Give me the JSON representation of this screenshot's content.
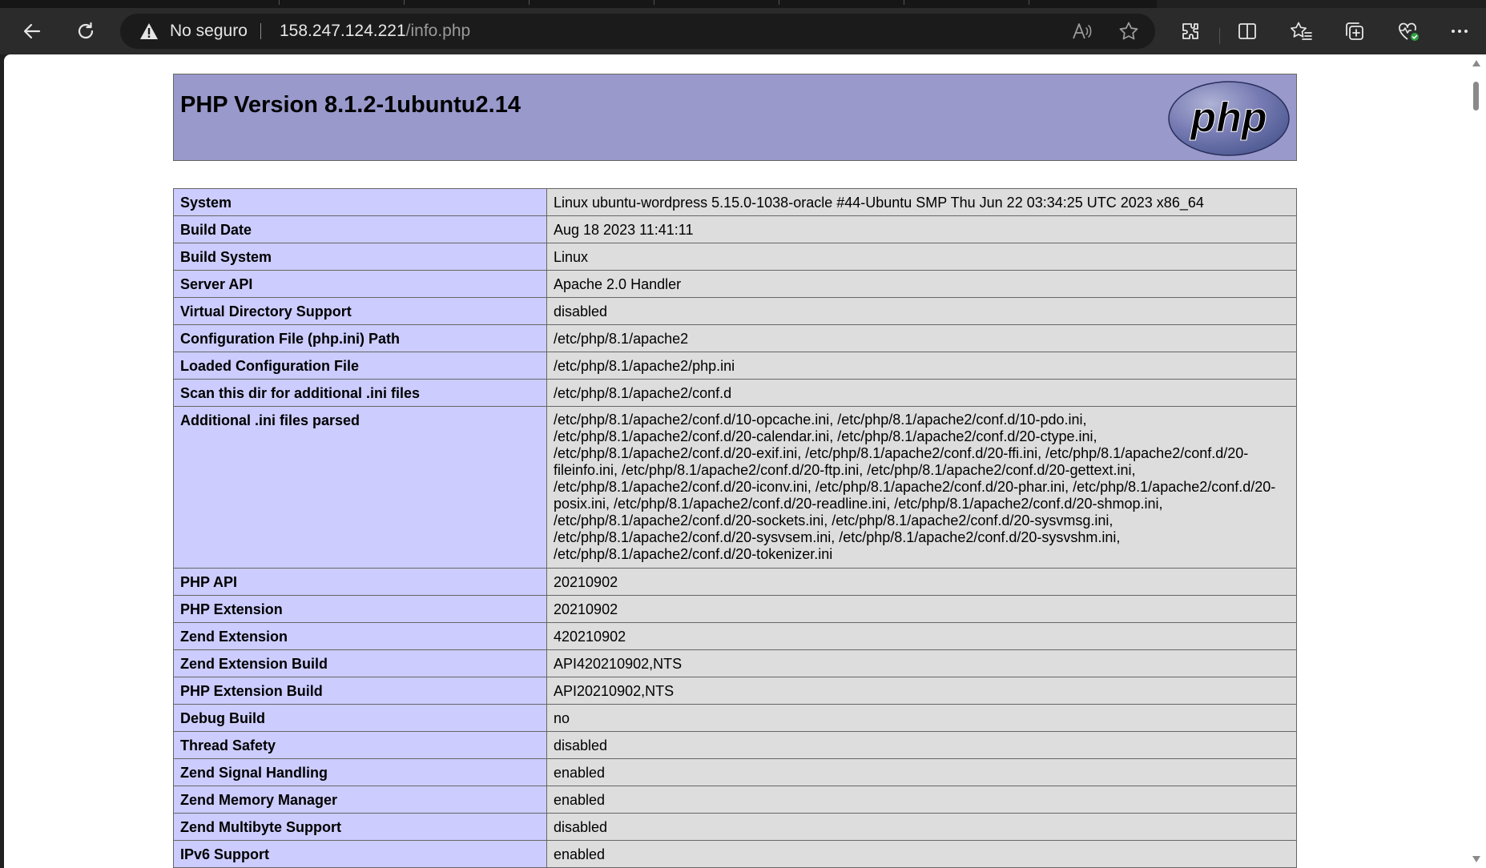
{
  "browser": {
    "security_label": "No seguro",
    "url_host": "158.247.124.221",
    "url_path": "/info.php",
    "icons": [
      "back-icon",
      "refresh-icon",
      "warning-icon",
      "read-aloud-icon",
      "favorite-star-icon",
      "extensions-icon",
      "split-screen-icon",
      "favorites-icon",
      "collections-icon",
      "browser-essentials-icon",
      "more-icon"
    ]
  },
  "php": {
    "version_title": "PHP Version 8.1.2-1ubuntu2.14",
    "logo_text": "php",
    "rows": [
      {
        "key": "System",
        "value": "Linux ubuntu-wordpress 5.15.0-1038-oracle #44-Ubuntu SMP Thu Jun 22 03:34:25 UTC 2023 x86_64"
      },
      {
        "key": "Build Date",
        "value": "Aug 18 2023 11:41:11"
      },
      {
        "key": "Build System",
        "value": "Linux"
      },
      {
        "key": "Server API",
        "value": "Apache 2.0 Handler"
      },
      {
        "key": "Virtual Directory Support",
        "value": "disabled"
      },
      {
        "key": "Configuration File (php.ini) Path",
        "value": "/etc/php/8.1/apache2"
      },
      {
        "key": "Loaded Configuration File",
        "value": "/etc/php/8.1/apache2/php.ini"
      },
      {
        "key": "Scan this dir for additional .ini files",
        "value": "/etc/php/8.1/apache2/conf.d"
      },
      {
        "key": "Additional .ini files parsed",
        "value": "/etc/php/8.1/apache2/conf.d/10-opcache.ini, /etc/php/8.1/apache2/conf.d/10-pdo.ini, /etc/php/8.1/apache2/conf.d/20-calendar.ini, /etc/php/8.1/apache2/conf.d/20-ctype.ini, /etc/php/8.1/apache2/conf.d/20-exif.ini, /etc/php/8.1/apache2/conf.d/20-ffi.ini, /etc/php/8.1/apache2/conf.d/20-fileinfo.ini, /etc/php/8.1/apache2/conf.d/20-ftp.ini, /etc/php/8.1/apache2/conf.d/20-gettext.ini, /etc/php/8.1/apache2/conf.d/20-iconv.ini, /etc/php/8.1/apache2/conf.d/20-phar.ini, /etc/php/8.1/apache2/conf.d/20-posix.ini, /etc/php/8.1/apache2/conf.d/20-readline.ini, /etc/php/8.1/apache2/conf.d/20-shmop.ini, /etc/php/8.1/apache2/conf.d/20-sockets.ini, /etc/php/8.1/apache2/conf.d/20-sysvmsg.ini, /etc/php/8.1/apache2/conf.d/20-sysvsem.ini, /etc/php/8.1/apache2/conf.d/20-sysvshm.ini, /etc/php/8.1/apache2/conf.d/20-tokenizer.ini"
      },
      {
        "key": "PHP API",
        "value": "20210902"
      },
      {
        "key": "PHP Extension",
        "value": "20210902"
      },
      {
        "key": "Zend Extension",
        "value": "420210902"
      },
      {
        "key": "Zend Extension Build",
        "value": "API420210902,NTS"
      },
      {
        "key": "PHP Extension Build",
        "value": "API20210902,NTS"
      },
      {
        "key": "Debug Build",
        "value": "no"
      },
      {
        "key": "Thread Safety",
        "value": "disabled"
      },
      {
        "key": "Zend Signal Handling",
        "value": "enabled"
      },
      {
        "key": "Zend Memory Manager",
        "value": "enabled"
      },
      {
        "key": "Zend Multibyte Support",
        "value": "disabled"
      },
      {
        "key": "IPv6 Support",
        "value": "enabled"
      }
    ]
  }
}
